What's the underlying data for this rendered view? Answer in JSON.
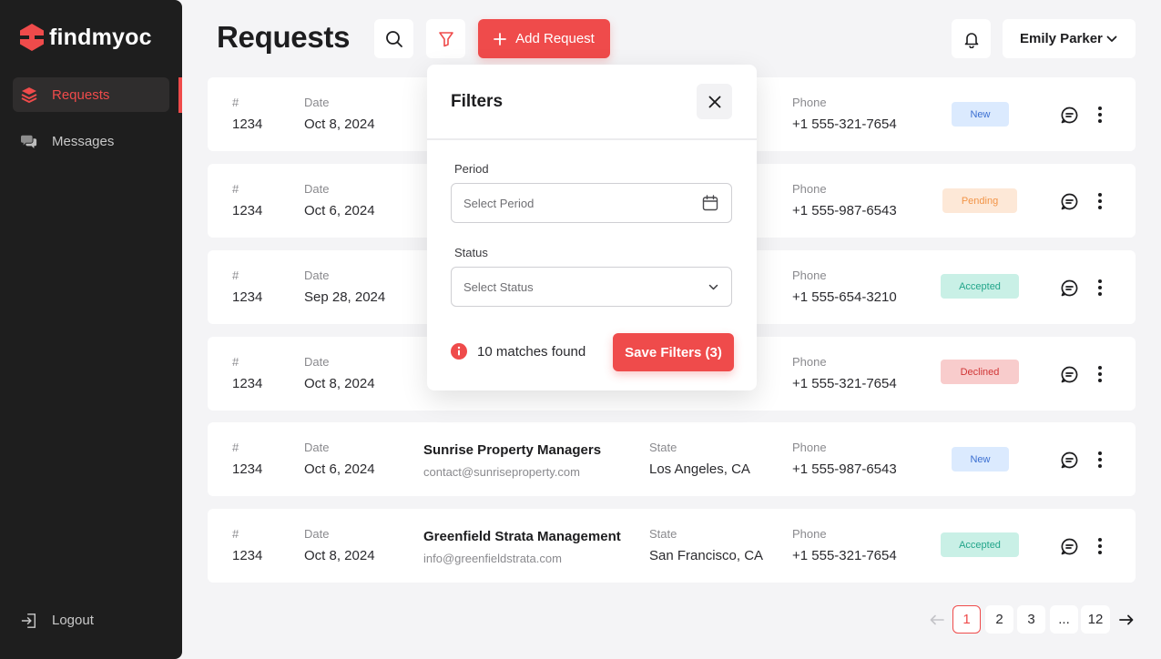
{
  "brand": {
    "name": "findmyoc",
    "accent": "#ef4b4b"
  },
  "sidebar": {
    "items": [
      {
        "label": "Requests",
        "icon": "layers-icon",
        "active": true
      },
      {
        "label": "Messages",
        "icon": "chat-bubbles-icon",
        "active": false
      }
    ],
    "logout_label": "Logout"
  },
  "header": {
    "title": "Requests",
    "add_label": "Add Request",
    "user_name": "Emily Parker"
  },
  "columns": {
    "number": "#",
    "date": "Date",
    "state": "State",
    "phone": "Phone"
  },
  "rows": [
    {
      "number": "1234",
      "date": "Oct 8, 2024",
      "org": "",
      "email": "",
      "state": "",
      "phone": "+1 555-321-7654",
      "status": "New"
    },
    {
      "number": "1234",
      "date": "Oct 6, 2024",
      "org": "",
      "email": "",
      "state": "",
      "phone": "+1 555-987-6543",
      "status": "Pending"
    },
    {
      "number": "1234",
      "date": "Sep 28, 2024",
      "org": "",
      "email": "",
      "state": "",
      "phone": "+1 555-654-3210",
      "status": "Accepted"
    },
    {
      "number": "1234",
      "date": "Oct 8, 2024",
      "org": "",
      "email": "",
      "state": "",
      "phone": "+1 555-321-7654",
      "status": "Declined"
    },
    {
      "number": "1234",
      "date": "Oct 6, 2024",
      "org": "Sunrise Property Managers",
      "email": "contact@sunriseproperty.com",
      "state": "Los Angeles, CA",
      "phone": "+1 555-987-6543",
      "status": "New"
    },
    {
      "number": "1234",
      "date": "Oct 8, 2024",
      "org": "Greenfield Strata Management",
      "email": "info@greenfieldstrata.com",
      "state": "San Francisco, CA",
      "phone": "+1 555-321-7654",
      "status": "Accepted"
    }
  ],
  "status_colors": {
    "New": {
      "bg": "#dbeafe",
      "fg": "#3b6fd1"
    },
    "Pending": {
      "bg": "#fde8d7",
      "fg": "#f29447"
    },
    "Accepted": {
      "bg": "#c9f0e6",
      "fg": "#22a58a"
    },
    "Declined": {
      "bg": "#f8cccc",
      "fg": "#d03535"
    }
  },
  "filters": {
    "title": "Filters",
    "period_label": "Period",
    "period_placeholder": "Select Period",
    "status_label": "Status",
    "status_placeholder": "Select Status",
    "matches_text": "10 matches found",
    "save_label": "Save Filters (3)"
  },
  "pagination": {
    "pages": [
      "1",
      "2",
      "3",
      "...",
      "12"
    ],
    "current": "1"
  }
}
